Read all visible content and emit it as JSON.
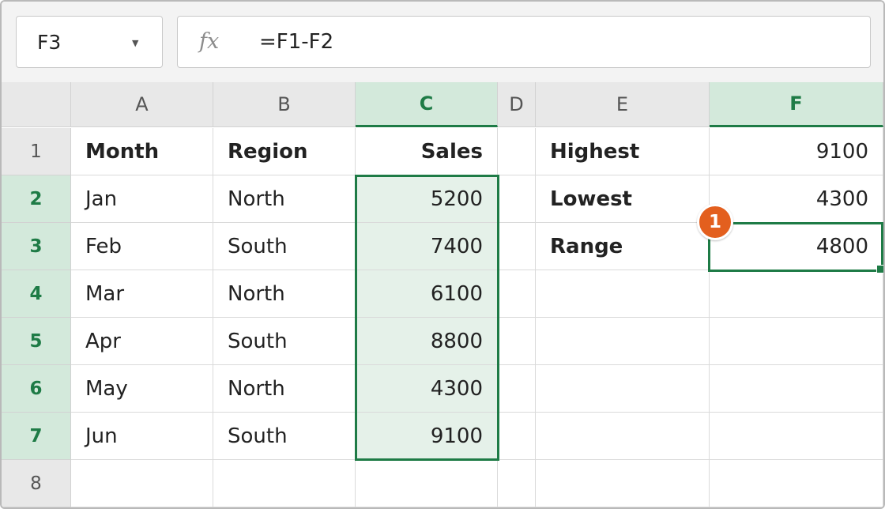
{
  "name_box": {
    "value": "F3"
  },
  "formula_bar": {
    "fx_label": "fx",
    "formula": "=F1-F2"
  },
  "columns": [
    "A",
    "B",
    "C",
    "D",
    "E",
    "F"
  ],
  "rows": [
    "1",
    "2",
    "3",
    "4",
    "5",
    "6",
    "7",
    "8"
  ],
  "cells": {
    "A1": "Month",
    "B1": "Region",
    "C1": "Sales",
    "E1": "Highest",
    "F1": "9100",
    "A2": "Jan",
    "B2": "North",
    "C2": "5200",
    "E2": "Lowest",
    "F2": "4300",
    "A3": "Feb",
    "B3": "South",
    "C3": "7400",
    "E3": "Range",
    "F3": "4800",
    "A4": "Mar",
    "B4": "North",
    "C4": "6100",
    "A5": "Apr",
    "B5": "South",
    "C5": "8800",
    "A6": "May",
    "B6": "North",
    "C6": "4300",
    "A7": "Jun",
    "B7": "South",
    "C7": "9100"
  },
  "selection": {
    "active_cell": "F3",
    "highlighted_range": "C2:C7",
    "highlighted_columns": [
      "C",
      "F"
    ],
    "highlighted_rows": [
      "2",
      "3",
      "4",
      "5",
      "6",
      "7"
    ]
  },
  "callout": {
    "number": "1"
  },
  "colors": {
    "accent_green": "#1e7b46",
    "selection_fill": "#e5f1e9",
    "header_selected": "#d3e9db",
    "callout_orange": "#e35f1e"
  }
}
